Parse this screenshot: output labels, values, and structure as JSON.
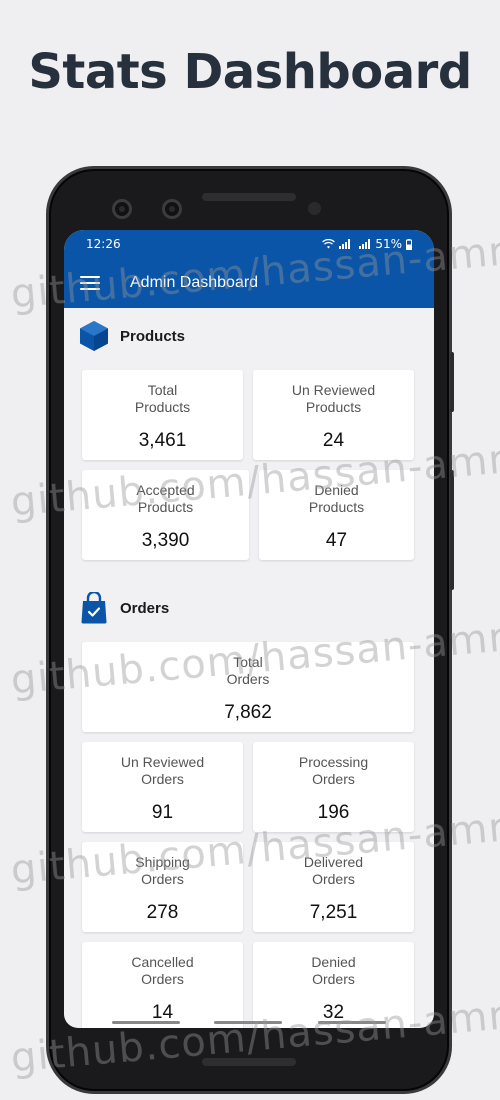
{
  "promo": {
    "title": "Stats Dashboard"
  },
  "status_bar": {
    "time": "12:26",
    "battery": "51%"
  },
  "app_bar": {
    "title": "Admin Dashboard"
  },
  "products": {
    "section_title": "Products",
    "cards": [
      {
        "label": "Total\nProducts",
        "value": "3,461"
      },
      {
        "label": "Un Reviewed\nProducts",
        "value": "24"
      },
      {
        "label": "Accepted\nProducts",
        "value": "3,390"
      },
      {
        "label": "Denied\nProducts",
        "value": "47"
      }
    ]
  },
  "orders": {
    "section_title": "Orders",
    "cards": [
      {
        "label": "Total\nOrders",
        "value": "7,862"
      },
      {
        "label": "Un Reviewed\nOrders",
        "value": "91"
      },
      {
        "label": "Processing\nOrders",
        "value": "196"
      },
      {
        "label": "Shipping\nOrders",
        "value": "278"
      },
      {
        "label": "Delivered\nOrders",
        "value": "7,251"
      },
      {
        "label": "Cancelled\nOrders",
        "value": "14"
      },
      {
        "label": "Denied\nOrders",
        "value": "32"
      }
    ]
  },
  "watermark": {
    "text": "github.com/hassan-amr"
  },
  "colors": {
    "primary": "#0a55a8",
    "background": "#f1f0f3",
    "card": "#ffffff"
  }
}
